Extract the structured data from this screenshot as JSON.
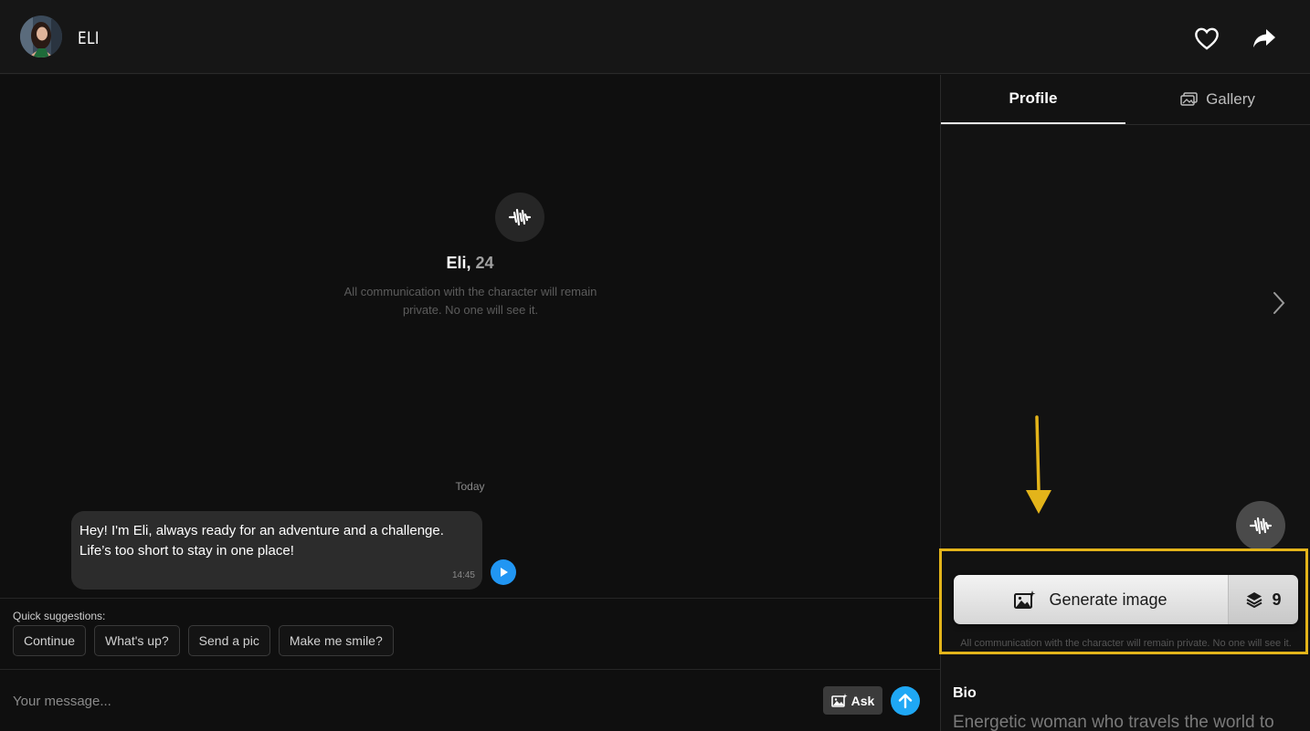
{
  "header": {
    "character_name": "ELI",
    "favorite_icon": "heart-icon",
    "share_icon": "share-icon"
  },
  "chat": {
    "intro": {
      "name": "Eli,",
      "age": "24",
      "privacy_note": "All communication with the character will remain private. No one will see it."
    },
    "day_separator": "Today",
    "messages": [
      {
        "text": "Hey! I'm Eli, always ready for an adventure and a challenge.\nLife’s too short to stay in one place!",
        "time": "14:45"
      }
    ],
    "quick_suggestions": {
      "label": "Quick suggestions:",
      "items": [
        "Continue",
        "What's up?",
        "Send a pic",
        "Make me smile?"
      ]
    },
    "input": {
      "placeholder": "Your message...",
      "ask_label": "Ask"
    }
  },
  "panel": {
    "tabs": [
      {
        "label": "Profile",
        "active": true
      },
      {
        "label": "Gallery",
        "active": false
      }
    ],
    "generate": {
      "label": "Generate image",
      "count": "9",
      "note": "All communication with the character will remain private. No one will see it."
    },
    "bio": {
      "title": "Bio",
      "text": "Energetic woman who travels the world to"
    }
  },
  "colors": {
    "background": "#0f0f0f",
    "accent_blue": "#1fa8f5",
    "highlight": "#e3b41a"
  }
}
